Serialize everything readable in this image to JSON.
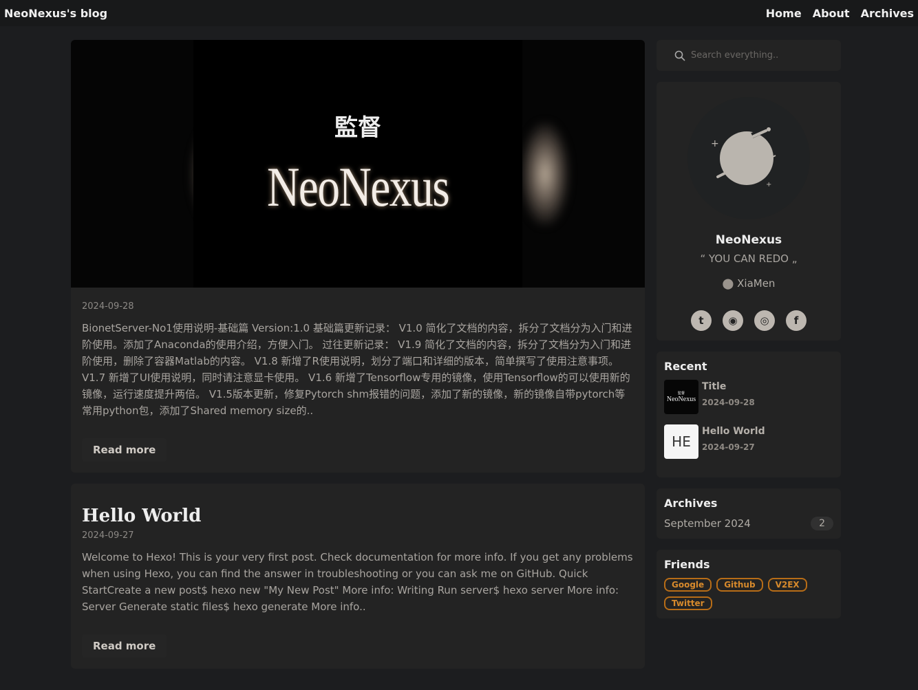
{
  "nav": {
    "brand": "NeoNexus's blog",
    "links": [
      "Home",
      "About",
      "Archives"
    ]
  },
  "posts": [
    {
      "hero_kanji": "監督",
      "hero_logo": "NeoNexus",
      "date": "2024-09-28",
      "excerpt": "BionetServer-No1使用说明-基础篇 Version:1.0 基础篇更新记录： V1.0 简化了文档的内容，拆分了文档分为入门和进阶使用。添加了Anaconda的使用介绍，方便入门。 过往更新记录： V1.9 简化了文档的内容，拆分了文档分为入门和进阶使用，删除了容器Matlab的内容。 V1.8 新增了R使用说明，划分了端口和详细的版本，简单撰写了使用注意事项。 V1.7 新增了UI使用说明，同时请注意显卡使用。 V1.6 新增了Tensorflow专用的镜像，使用Tensorflow的可以使用新的镜像，运行速度提升两倍。 V1.5版本更新，修复Pytorch shm报错的问题，添加了新的镜像，新的镜像自带pytorch等常用python包，添加了Shared memory size的..",
      "read_more": "Read more"
    },
    {
      "title": "Hello World",
      "date": "2024-09-27",
      "excerpt": "Welcome to Hexo! This is your very first post. Check documentation for more info. If you get any problems when using Hexo, you can find the answer in troubleshooting or you can ask me on GitHub. Quick StartCreate a new post$ hexo new \"My New Post\" More info: Writing Run server$ hexo server More info: Server Generate static files$ hexo generate More info..",
      "read_more": "Read more"
    }
  ],
  "sidebar": {
    "search_placeholder": "Search everything..",
    "profile": {
      "name": "NeoNexus",
      "open_quote": "“",
      "motto": "YOU CAN REDO",
      "close_quote": "„",
      "location": "XiaMen"
    },
    "recent": {
      "title": "Recent",
      "items": [
        {
          "thumb_kanji": "監督",
          "thumb_logo": "NeoNexus",
          "title": "Title",
          "date": "2024-09-28"
        },
        {
          "thumb": "HE",
          "title": "Hello World",
          "date": "2024-09-27"
        }
      ]
    },
    "archives": {
      "title": "Archives",
      "items": [
        {
          "label": "September 2024",
          "count": "2"
        }
      ]
    },
    "friends": {
      "title": "Friends",
      "links": [
        "Google",
        "Github",
        "V2EX",
        "Twitter"
      ]
    }
  }
}
